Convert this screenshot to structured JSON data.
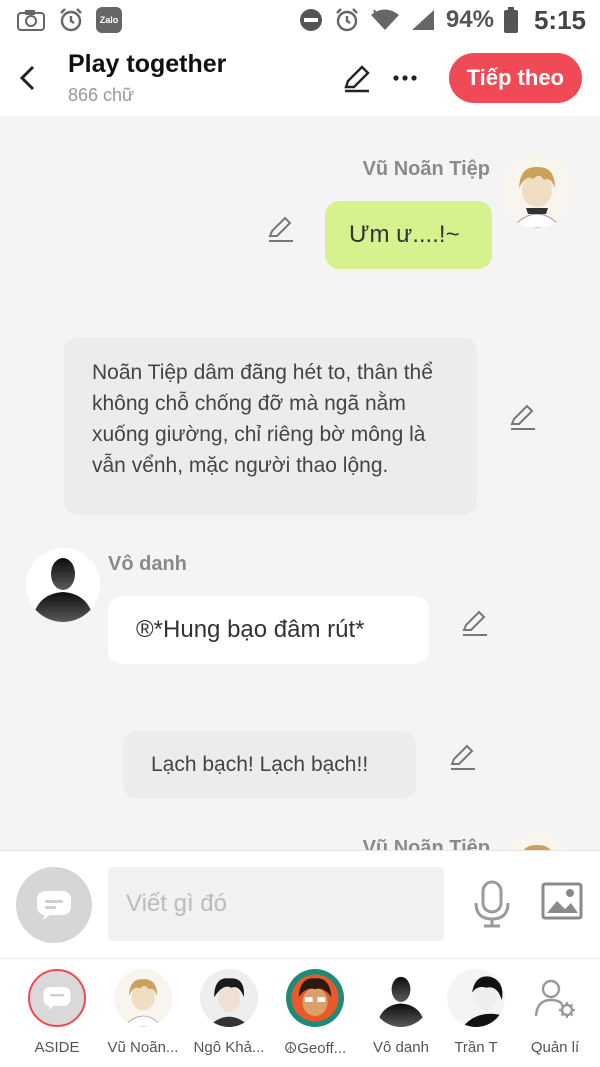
{
  "status_bar": {
    "battery": "94%",
    "time": "5:15",
    "app_badge": "Zalo"
  },
  "header": {
    "title": "Play together",
    "subtitle": "866 chữ",
    "next_label": "Tiếp theo"
  },
  "messages": [
    {
      "type": "right",
      "name": "Vũ Noãn Tiệp",
      "text": "Ưm ư....!~",
      "bubble_color": "#d6f28e"
    },
    {
      "type": "narration",
      "text": "Noãn Tiệp dâm đãng hét to, thân thể không chỗ chống đỡ mà ngã nằm xuống giường, chỉ riêng bờ mông là vẫn vểnh, mặc người thao lộng."
    },
    {
      "type": "left",
      "name": "Vô danh",
      "text": "®*Hung bạo đâm rút*"
    },
    {
      "type": "narration",
      "text": "Lạch bạch! Lạch bạch!!"
    },
    {
      "type": "right",
      "name": "Vũ Noãn Tiệp"
    }
  ],
  "composer": {
    "placeholder": "Viết gì đó"
  },
  "characters": [
    {
      "label": "ASIDE"
    },
    {
      "label": "Vũ Noãn..."
    },
    {
      "label": "Ngô Khả..."
    },
    {
      "label": "☮Geoff..."
    },
    {
      "label": "Vô danh"
    },
    {
      "label": "Trần T"
    },
    {
      "label": "Quản lí"
    }
  ],
  "colors": {
    "accent": "#ef4a56",
    "right_bubble": "#d6f28e",
    "narration_bubble": "#ececec",
    "left_bubble": "#ffffff"
  }
}
